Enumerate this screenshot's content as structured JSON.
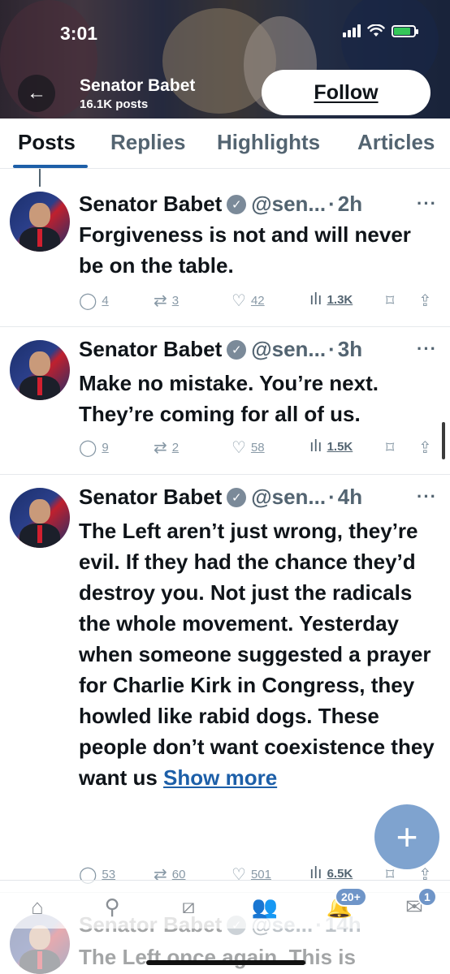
{
  "status_bar": {
    "time": "3:01"
  },
  "header": {
    "back_icon": "arrow-left-icon",
    "name": "Senator Babet",
    "post_count": "16.1K posts",
    "follow_label": "Follow"
  },
  "tabs": [
    {
      "label": "Posts",
      "active": true
    },
    {
      "label": "Replies",
      "active": false
    },
    {
      "label": "Highlights",
      "active": false
    },
    {
      "label": "Articles",
      "active": false
    }
  ],
  "posts": [
    {
      "name": "Senator Babet",
      "handle": "@sen...",
      "time": "2h",
      "text": "Forgiveness is not and will never be on the table.",
      "replies": "4",
      "reposts": "3",
      "likes": "42",
      "views": "1.3K"
    },
    {
      "name": "Senator Babet",
      "handle": "@sen...",
      "time": "3h",
      "text": "Make no mistake. You’re next. They’re coming for all of us.",
      "replies": "9",
      "reposts": "2",
      "likes": "58",
      "views": "1.5K"
    },
    {
      "name": "Senator Babet",
      "handle": "@sen...",
      "time": "4h",
      "text": "The Left aren’t just wrong, they’re evil. If they had the chance they’d destroy you. Not just the radicals the whole movement. Yesterday when someone suggested a prayer for Charlie Kirk in Congress, they howled like rabid dogs. These people don’t want coexistence they want us",
      "show_more": "Show more",
      "replies": "53",
      "reposts": "60",
      "likes": "501",
      "views": "6.5K"
    },
    {
      "name": "Senator Babet",
      "handle": "@se...",
      "time": "14h",
      "text": "The Left once again. This is"
    }
  ],
  "bottom_nav": {
    "notifications_badge": "20+",
    "messages_badge": "1"
  },
  "fab_label": "+",
  "colors": {
    "accent": "#1d5fa8",
    "fab": "#7fa3cf",
    "muted": "#536471"
  }
}
